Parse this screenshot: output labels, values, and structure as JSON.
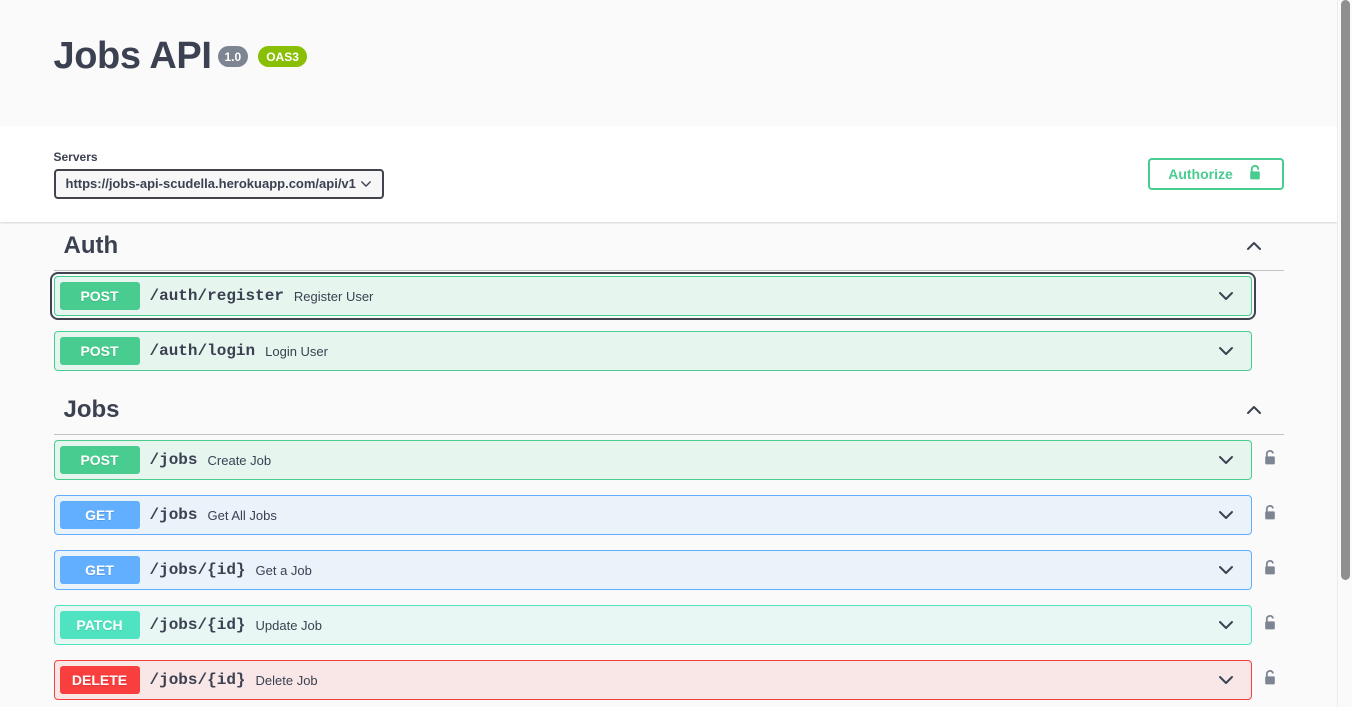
{
  "header": {
    "title": "Jobs API",
    "version_badge": "1.0",
    "oas_badge": "OAS3"
  },
  "servers": {
    "label": "Servers",
    "selected": "https://jobs-api-scudella.herokuapp.com/api/v1",
    "options": [
      "https://jobs-api-scudella.herokuapp.com/api/v1"
    ],
    "caret_icon": "chevron-down-icon"
  },
  "authorize": {
    "label": "Authorize",
    "icon": "unlock-icon",
    "color": "#49cc90"
  },
  "colors": {
    "post": "#49cc90",
    "get": "#61affe",
    "patch": "#50e3c2",
    "delete": "#f93e3e",
    "oas": "#89bf04",
    "version": "#7d8492",
    "text": "#3b4151"
  },
  "sections": [
    {
      "name": "Auth",
      "collapse_icon": "chevron-up-icon",
      "operations": [
        {
          "method": "POST",
          "method_class": "op-post",
          "path": "/auth/register",
          "description": "Register User",
          "arrow_icon": "chevron-down-icon",
          "focused": true,
          "locked": false
        },
        {
          "method": "POST",
          "method_class": "op-post",
          "path": "/auth/login",
          "description": "Login User",
          "arrow_icon": "chevron-down-icon",
          "focused": false,
          "locked": false
        }
      ]
    },
    {
      "name": "Jobs",
      "collapse_icon": "chevron-up-icon",
      "operations": [
        {
          "method": "POST",
          "method_class": "op-post",
          "path": "/jobs",
          "description": "Create Job",
          "arrow_icon": "chevron-down-icon",
          "focused": false,
          "locked": true
        },
        {
          "method": "GET",
          "method_class": "op-get",
          "path": "/jobs",
          "description": "Get All Jobs",
          "arrow_icon": "chevron-down-icon",
          "focused": false,
          "locked": true
        },
        {
          "method": "GET",
          "method_class": "op-get",
          "path": "/jobs/{id}",
          "description": "Get a Job",
          "arrow_icon": "chevron-down-icon",
          "focused": false,
          "locked": true
        },
        {
          "method": "PATCH",
          "method_class": "op-patch",
          "path": "/jobs/{id}",
          "description": "Update Job",
          "arrow_icon": "chevron-down-icon",
          "focused": false,
          "locked": true
        },
        {
          "method": "DELETE",
          "method_class": "op-delete",
          "path": "/jobs/{id}",
          "description": "Delete Job",
          "arrow_icon": "chevron-down-icon",
          "focused": false,
          "locked": true
        }
      ]
    }
  ],
  "scrollbar": {
    "name": "vertical-scrollbar"
  }
}
